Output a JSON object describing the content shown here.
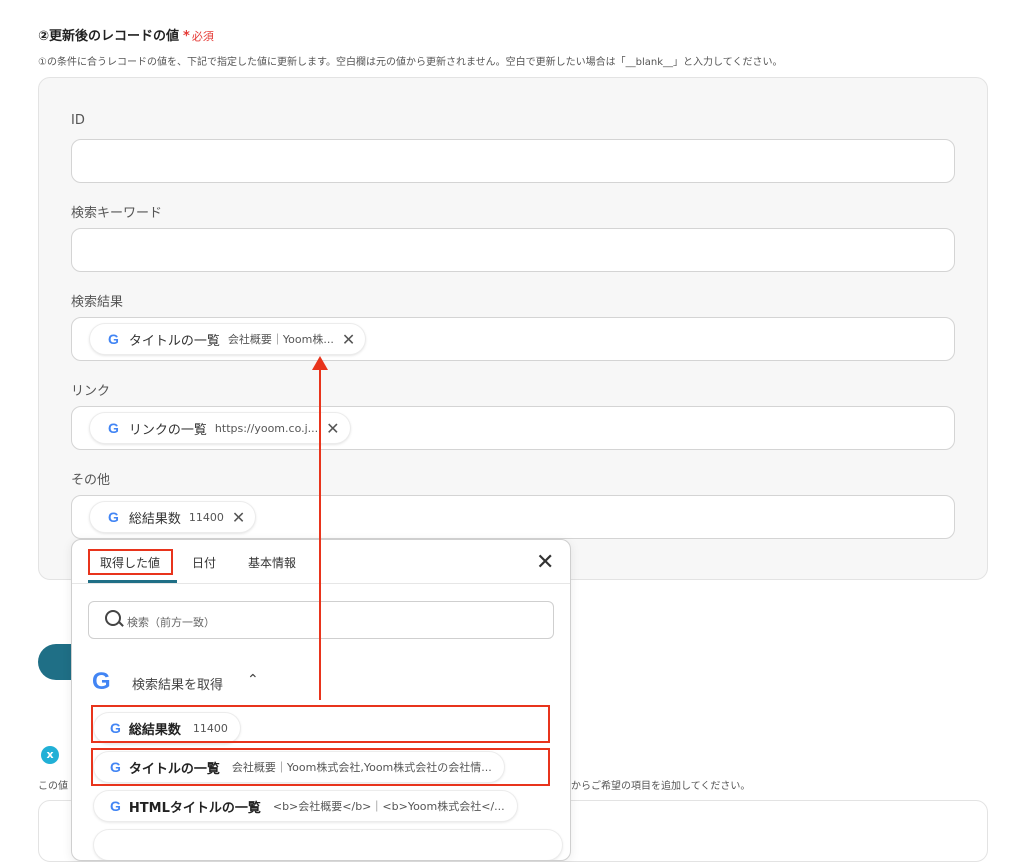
{
  "section": {
    "title": "②更新後のレコードの値",
    "required_star": "*",
    "required_label": "必須",
    "description": "①の条件に合うレコードの値を、下記で指定した値に更新します。空白欄は元の値から更新されません。空白で更新したい場合は「__blank__」と入力してください。"
  },
  "fields": {
    "id": {
      "label": "ID"
    },
    "keyword": {
      "label": "検索キーワード"
    },
    "results": {
      "label": "検索結果",
      "chip": {
        "icon": "G",
        "name": "タイトルの一覧",
        "value": "会社概要｜Yoom株..."
      }
    },
    "link": {
      "label": "リンク",
      "chip": {
        "icon": "G",
        "name": "リンクの一覧",
        "value": "https://yoom.co.j..."
      }
    },
    "other": {
      "label": "その他",
      "chip": {
        "icon": "G",
        "name": "総結果数",
        "value": "11400"
      }
    }
  },
  "chip_close_glyph": "✕",
  "background": {
    "badge": "x",
    "desc_left": "この値",
    "desc_right": "からご希望の項目を追加してください。"
  },
  "dropdown": {
    "tabs": [
      "取得した値",
      "日付",
      "基本情報"
    ],
    "close_glyph": "✕",
    "search_placeholder": "検索（前方一致）",
    "group": {
      "icon": "G",
      "label": "検索結果を取得",
      "chevron": "⌃"
    },
    "items": [
      {
        "icon": "G",
        "name": "総結果数",
        "value": "11400"
      },
      {
        "icon": "G",
        "name": "タイトルの一覧",
        "value": "会社概要｜Yoom株式会社,Yoom株式会社の会社情..."
      },
      {
        "icon": "G",
        "name": "HTMLタイトルの一覧",
        "value": "<b>会社概要</b>｜<b>Yoom株式会社</..."
      }
    ]
  },
  "colors": {
    "accent": "#1f6f86",
    "highlight": "#e8341c",
    "required": "#e53935",
    "google_blue": "#4285F4"
  }
}
